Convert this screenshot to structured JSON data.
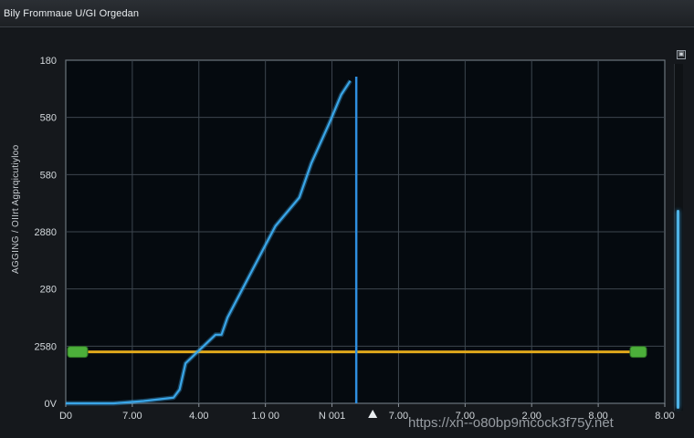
{
  "window": {
    "title": "Bily Frommaue U/GI Orgedan",
    "corner_glyph": "▣"
  },
  "y_axis_title": "AGGING / OIIrt Agprqicutiyloo",
  "watermark": "https://xn--o80bp9mcock3f75y.net",
  "chart_data": {
    "type": "line",
    "title": "",
    "xlabel": "",
    "ylabel": "AGGING / OIIrt Agprqicutiyloo",
    "y_ticks": [
      "180",
      "580",
      "580",
      "2880",
      "280",
      "2580",
      "0V"
    ],
    "x_ticks": [
      "D0",
      "7.00",
      "4.00",
      "1.0 00",
      "N 001",
      "7.00",
      "7.00",
      "2.00",
      "8.00",
      "8.00"
    ],
    "series": [
      {
        "color": "#3aa6e8",
        "points": [
          [
            0,
            0
          ],
          [
            0.8,
            0
          ],
          [
            1.3,
            0.02
          ],
          [
            1.8,
            0.05
          ],
          [
            1.9,
            0.12
          ],
          [
            2.0,
            0.35
          ],
          [
            2.2,
            0.45
          ],
          [
            2.5,
            0.6
          ],
          [
            2.6,
            0.6
          ],
          [
            2.7,
            0.75
          ],
          [
            3.0,
            1.05
          ],
          [
            3.3,
            1.35
          ],
          [
            3.5,
            1.55
          ],
          [
            3.9,
            1.8
          ],
          [
            4.1,
            2.1
          ],
          [
            4.4,
            2.45
          ],
          [
            4.6,
            2.7
          ],
          [
            4.75,
            2.82
          ]
        ]
      }
    ],
    "threshold_line": {
      "value": 0.45,
      "color": "#e0a81c"
    },
    "cursor_line": {
      "x": 4.85,
      "color": "#2f8fe0"
    },
    "xlim": [
      0,
      10
    ],
    "ylim": [
      0,
      3
    ],
    "grid": true
  }
}
